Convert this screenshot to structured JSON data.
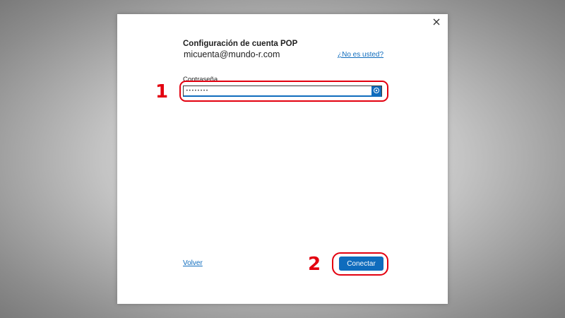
{
  "dialog": {
    "title": "Configuración de cuenta POP",
    "account_email": "micuenta@mundo-r.com",
    "not_you_link": "¿No es usted?",
    "close_icon": "close-icon"
  },
  "password": {
    "label": "Contraseña",
    "masked_value": "••••••••",
    "reveal_icon": "eye-icon"
  },
  "footer": {
    "back_link": "Volver",
    "connect_button": "Conectar"
  },
  "annotations": {
    "step_1": "1",
    "step_2": "2",
    "highlight_color": "#e3000f"
  },
  "colors": {
    "accent": "#0f6cbd"
  }
}
